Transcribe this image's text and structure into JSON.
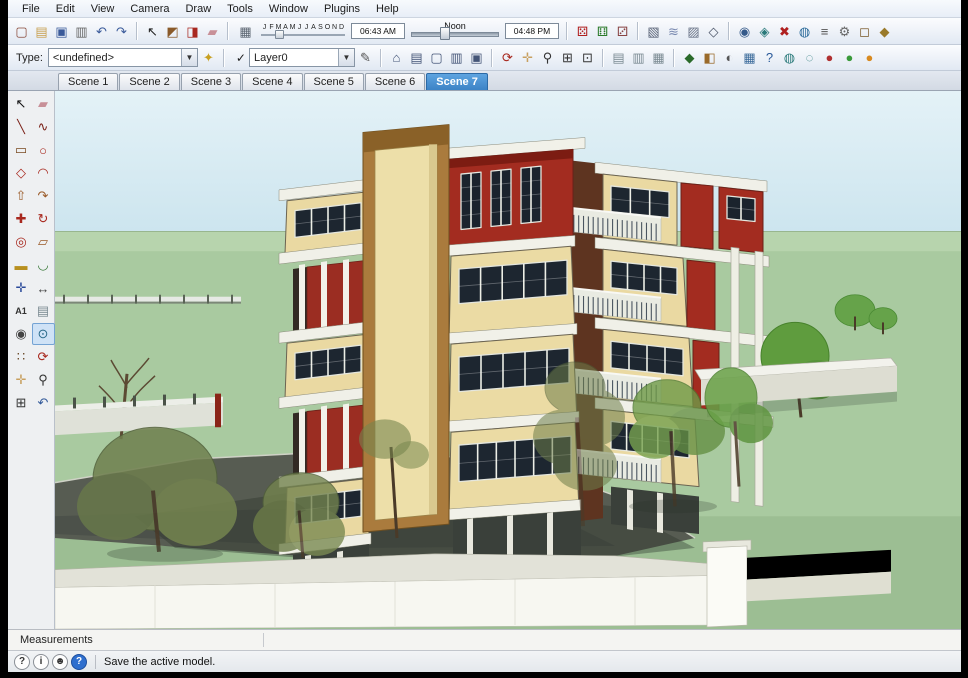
{
  "menu": {
    "items": [
      "File",
      "Edit",
      "View",
      "Camera",
      "Draw",
      "Tools",
      "Window",
      "Plugins",
      "Help"
    ]
  },
  "toolbar1": {
    "standard": [
      {
        "name": "new",
        "glyph": "▢",
        "color": "#8a4a3a"
      },
      {
        "name": "open",
        "glyph": "▤",
        "color": "#c8a050"
      },
      {
        "name": "save",
        "glyph": "▣",
        "color": "#3a5a9a"
      },
      {
        "name": "print",
        "glyph": "▥",
        "color": "#666666"
      },
      {
        "name": "undo",
        "glyph": "↶",
        "color": "#3a5a9a"
      },
      {
        "name": "redo",
        "glyph": "↷",
        "color": "#3a5a9a"
      }
    ],
    "cursors": [
      {
        "name": "select",
        "glyph": "↖",
        "color": "#222222"
      },
      {
        "name": "make-component",
        "glyph": "◩",
        "color": "#8a5a2a"
      },
      {
        "name": "paint-bucket",
        "glyph": "◨",
        "color": "#a82820"
      },
      {
        "name": "erase",
        "glyph": "▰",
        "color": "#c89098"
      }
    ],
    "shadows": {
      "icon": {
        "name": "shadow-settings",
        "glyph": "▦",
        "color": "#5a6470"
      },
      "months": [
        "J",
        "F",
        "M",
        "A",
        "M",
        "J",
        "J",
        "A",
        "S",
        "O",
        "N",
        "D"
      ],
      "time_from": "06:43 AM",
      "noon": "Noon",
      "time_to": "04:48 PM"
    },
    "plugins": [
      {
        "name": "dice-red",
        "glyph": "⚄",
        "color": "#b02020"
      },
      {
        "name": "dice-green",
        "glyph": "⚅",
        "color": "#2a7a2a"
      },
      {
        "name": "dice-white",
        "glyph": "⚂",
        "color": "#884444"
      }
    ],
    "toggles": [
      {
        "name": "shadow-toggle",
        "glyph": "▧",
        "color": "#5a6478"
      },
      {
        "name": "fog",
        "glyph": "≋",
        "color": "#7a8ab0"
      },
      {
        "name": "xray",
        "glyph": "▨",
        "color": "#6a7488"
      },
      {
        "name": "edge-style",
        "glyph": "◇",
        "color": "#4a5468"
      }
    ],
    "right": [
      {
        "name": "camera",
        "glyph": "◉",
        "color": "#355a8a"
      },
      {
        "name": "animation",
        "glyph": "◈",
        "color": "#2a7a7a"
      },
      {
        "name": "delete-scene",
        "glyph": "✖",
        "color": "#b02020"
      },
      {
        "name": "geo-location",
        "glyph": "◍",
        "color": "#2a6a9a"
      },
      {
        "name": "layers-list",
        "glyph": "≡",
        "color": "#555555"
      },
      {
        "name": "settings",
        "glyph": "⚙",
        "color": "#666666"
      },
      {
        "name": "model-box",
        "glyph": "◻",
        "color": "#7a5a2a"
      },
      {
        "name": "tag",
        "glyph": "◆",
        "color": "#9a7a2a"
      }
    ]
  },
  "toolbar2": {
    "type_label": "Type:",
    "type_value": "<undefined>",
    "gem": [
      {
        "name": "details",
        "glyph": "✦",
        "color": "#c8a020"
      }
    ],
    "layer_check": "✓",
    "layer_value": "Layer0",
    "pencil": [
      {
        "name": "pencil",
        "glyph": "✎",
        "color": "#555555"
      }
    ],
    "views": [
      {
        "name": "iso-view",
        "glyph": "⌂",
        "color": "#445577"
      },
      {
        "name": "top-view",
        "glyph": "▤",
        "color": "#445577"
      },
      {
        "name": "front-view",
        "glyph": "▢",
        "color": "#445577"
      },
      {
        "name": "side-view",
        "glyph": "▥",
        "color": "#445577"
      },
      {
        "name": "back-view",
        "glyph": "▣",
        "color": "#445577"
      }
    ],
    "camera": [
      {
        "name": "orbit",
        "glyph": "⟳",
        "color": "#a8281e"
      },
      {
        "name": "pan",
        "glyph": "✛",
        "color": "#c8a060"
      },
      {
        "name": "zoom",
        "glyph": "⚲",
        "color": "#333333"
      },
      {
        "name": "zoom-window",
        "glyph": "⊞",
        "color": "#333333"
      },
      {
        "name": "zoom-extents",
        "glyph": "⊡",
        "color": "#333333"
      }
    ],
    "section": [
      {
        "name": "section-plane",
        "glyph": "▤",
        "color": "#7a8a92"
      },
      {
        "name": "section-display",
        "glyph": "▥",
        "color": "#7a8a92"
      },
      {
        "name": "section-cut",
        "glyph": "▦",
        "color": "#7a8a92"
      }
    ],
    "right": [
      {
        "name": "components",
        "glyph": "◆",
        "color": "#2a6a2a"
      },
      {
        "name": "materials",
        "glyph": "◧",
        "color": "#9a6a2a"
      },
      {
        "name": "styles",
        "glyph": "◐",
        "color": "#555555"
      },
      {
        "name": "scenes-manager",
        "glyph": "▦",
        "color": "#3a6a9a"
      },
      {
        "name": "instructor",
        "glyph": "?",
        "color": "#2a5a9a"
      },
      {
        "name": "solid-union",
        "glyph": "◍",
        "color": "#2a7a7a"
      },
      {
        "name": "solid-subtract",
        "glyph": "◌",
        "color": "#2a7a7a"
      },
      {
        "name": "red-dot",
        "glyph": "●",
        "color": "#b03030"
      },
      {
        "name": "green-dot",
        "glyph": "●",
        "color": "#3a9a3a"
      },
      {
        "name": "orange-dot",
        "glyph": "●",
        "color": "#d88a20"
      }
    ]
  },
  "scene_tabs": {
    "tabs": [
      "Scene 1",
      "Scene 2",
      "Scene 3",
      "Scene 4",
      "Scene 5",
      "Scene 6",
      "Scene 7"
    ],
    "active_index": 6
  },
  "tool_palette": {
    "tools": [
      {
        "name": "select",
        "glyph": "↖",
        "color": "#111111"
      },
      {
        "name": "eraser",
        "glyph": "▰",
        "color": "#c89098"
      },
      {
        "name": "line",
        "glyph": "╲",
        "color": "#7a1f16"
      },
      {
        "name": "freehand",
        "glyph": "∿",
        "color": "#7a1f16"
      },
      {
        "name": "rectangle",
        "glyph": "▭",
        "color": "#7a4a20"
      },
      {
        "name": "circle",
        "glyph": "○",
        "color": "#a8281e"
      },
      {
        "name": "polygon",
        "glyph": "◇",
        "color": "#a8281e"
      },
      {
        "name": "arc",
        "glyph": "◠",
        "color": "#a8281e"
      },
      {
        "name": "push-pull",
        "glyph": "⇧",
        "color": "#9a5a28"
      },
      {
        "name": "follow-me",
        "glyph": "↷",
        "color": "#9a5a28"
      },
      {
        "name": "move",
        "glyph": "✚",
        "color": "#a8281e"
      },
      {
        "name": "rotate",
        "glyph": "↻",
        "color": "#a8281e"
      },
      {
        "name": "offset",
        "glyph": "◎",
        "color": "#a8281e"
      },
      {
        "name": "scale",
        "glyph": "▱",
        "color": "#9a5a28"
      },
      {
        "name": "tape-measure",
        "glyph": "▬",
        "color": "#b89020"
      },
      {
        "name": "protractor",
        "glyph": "◡",
        "color": "#3a7a3a"
      },
      {
        "name": "axes",
        "glyph": "✛",
        "color": "#2a4a9a"
      },
      {
        "name": "dimensions",
        "glyph": "↔",
        "color": "#444444"
      },
      {
        "name": "text",
        "glyph": "A1",
        "color": "#333333",
        "small": true
      },
      {
        "name": "section-plane",
        "glyph": "▤",
        "color": "#7a8a92"
      },
      {
        "name": "position-camera",
        "glyph": "◉",
        "color": "#444444"
      },
      {
        "name": "look-around",
        "glyph": "⊙",
        "color": "#2a6a8a",
        "selected": true
      },
      {
        "name": "walk",
        "glyph": "∷",
        "color": "#6a4a2a"
      },
      {
        "name": "orbit",
        "glyph": "⟳",
        "color": "#a8281e"
      },
      {
        "name": "pan",
        "glyph": "✛",
        "color": "#c8a060"
      },
      {
        "name": "zoom",
        "glyph": "⚲",
        "color": "#333333"
      },
      {
        "name": "zoom-extents",
        "glyph": "⊞",
        "color": "#333333"
      },
      {
        "name": "previous-view",
        "glyph": "↶",
        "color": "#335a9a"
      }
    ]
  },
  "measurements": {
    "label": "Measurements"
  },
  "status_bar": {
    "icons": [
      {
        "name": "help",
        "glyph": "?"
      },
      {
        "name": "info",
        "glyph": "i"
      },
      {
        "name": "user",
        "glyph": "☻"
      },
      {
        "name": "instructor-help",
        "glyph": "?",
        "blue": true
      }
    ],
    "text": "Save the active model."
  }
}
